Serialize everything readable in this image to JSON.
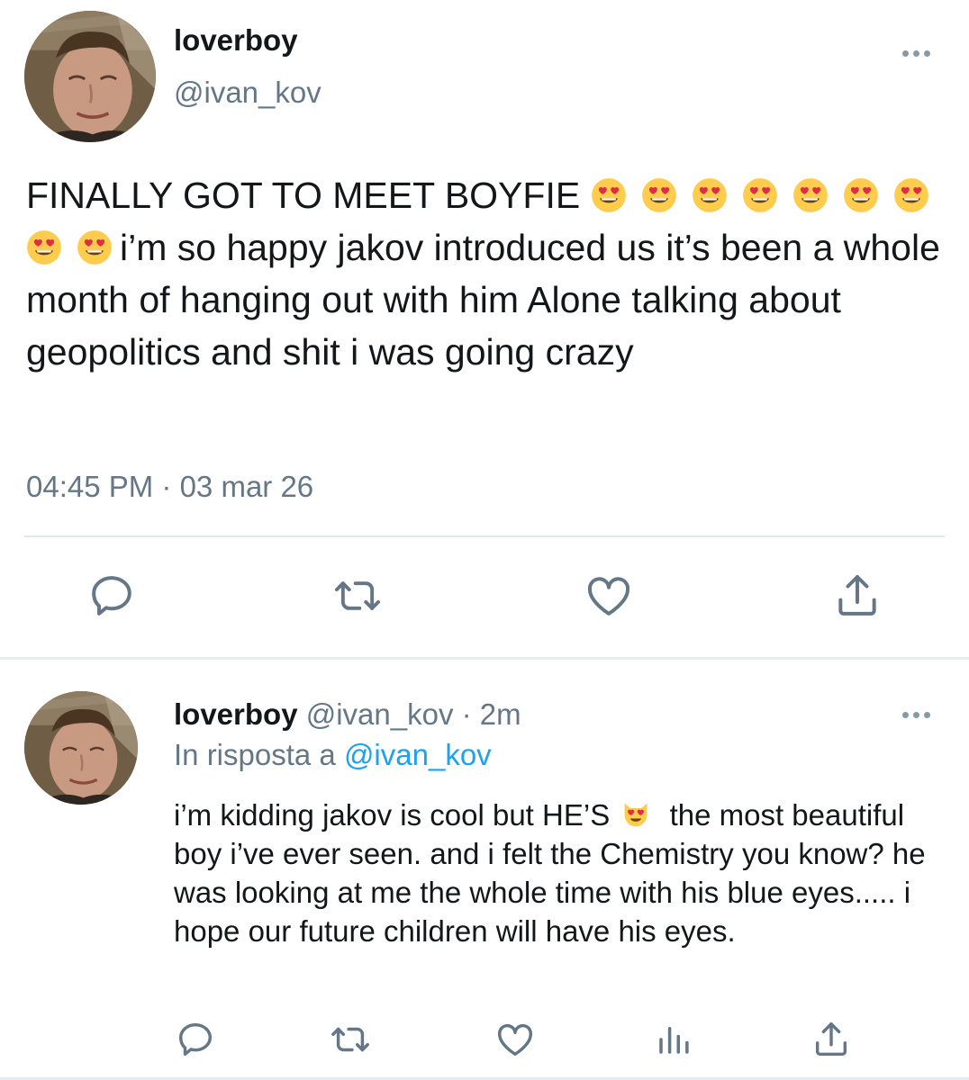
{
  "main_tweet": {
    "display_name": "loverboy",
    "handle": "@ivan_kov",
    "text_part1": "FINALLY GOT TO MEET BOYFIE",
    "text_part2": "i’m so happy jakov introduced us it’s been a whole month of hanging out with him Alone talking about geopolitics and shit i was going crazy",
    "emoji_name": "heart-eyes-emoji",
    "timestamp": "04:45 PM · 03 mar 26",
    "actions": [
      "reply-icon",
      "retweet-icon",
      "like-icon",
      "share-icon"
    ]
  },
  "reply_tweet": {
    "display_name": "loverboy",
    "handle": "@ivan_kov · 2m",
    "reply_prefix": "In risposta a",
    "reply_target": "@ivan_kov",
    "text_part1": "i’m kidding jakov is cool but HE’S",
    "emoji_name": "heart-eyes-cat-emoji",
    "text_part2": "the most beautiful boy i’ve ever seen. and i felt the Chemistry you know? he was looking at me the whole time with his blue eyes..... i hope our future children will have his eyes.",
    "actions": [
      "reply-icon",
      "retweet-icon",
      "like-icon",
      "analytics-icon",
      "share-icon"
    ]
  },
  "colors": {
    "text": "#14171a",
    "secondary": "#657786",
    "link": "#1da1f2",
    "icon": "#657786",
    "divider": "#e1e8ed"
  }
}
